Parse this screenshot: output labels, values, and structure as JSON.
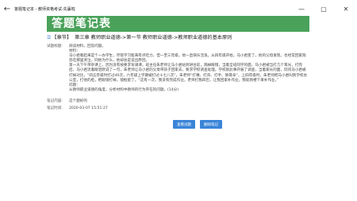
{
  "window": {
    "title": "答题笔记本 - 教师资格考试-先赢啦",
    "controls": [
      "—",
      "▢",
      "✕"
    ]
  },
  "header": {
    "title": "答题笔记表"
  },
  "chapter": {
    "icon": "list-icon",
    "tag": "【章节】",
    "text": "第三章 教师职业道德->第一节 教师职业道德->教师职业道德的基本原则"
  },
  "question": {
    "label": "试题标题:",
    "lines": [
      "阅读材料，回答问题。",
      "材料：",
      "马小君看起来是个一办学生，尽管学习能来有点吃力，但一至三年级，他一直快乐活泼。从四年级开始，马小君变了，他的父母发现，也经常回家抱怨在那里哭泣，同他为什么，他却总是说出原因。",
      "第一天下午带杂课上，因为没有按要求背诵课，班主任朱老师让马小君站到讲台前，隔掉眼镜，当着全班同学的面，马小君被当打几个耳光，打完后，马小君流着眼泪默说了一句，朱老师让马小君的父母带孩子回家去，要求学校调查处理。学校就此事开展了调查，当着家长的面，同问马小君被打掉对比，“四五年级时打过40次，六年级上学期被打过十七八次”，朱老师“打嘴、打背、打手、揪耳朵”，上四年级时，朱老师把马小君叫到学校办公室，打他的脸，把眼镜打掉，镜框套了。“这有一次，我没有完成作业，老师打我四巴，让我回家补作业，我就到楼下来补作业。”",
      "问题：",
      "从教师职业道德的角度，分析材料中教师的行为存在的问题。(14分)"
    ]
  },
  "note": {
    "label": "笔记内容:",
    "value": "这个题好的"
  },
  "time": {
    "label": "笔记时间:",
    "value": "2020-03-07 15:51:27"
  },
  "actions": {
    "view_label": "查看试题",
    "delete_label": "删除笔记"
  }
}
